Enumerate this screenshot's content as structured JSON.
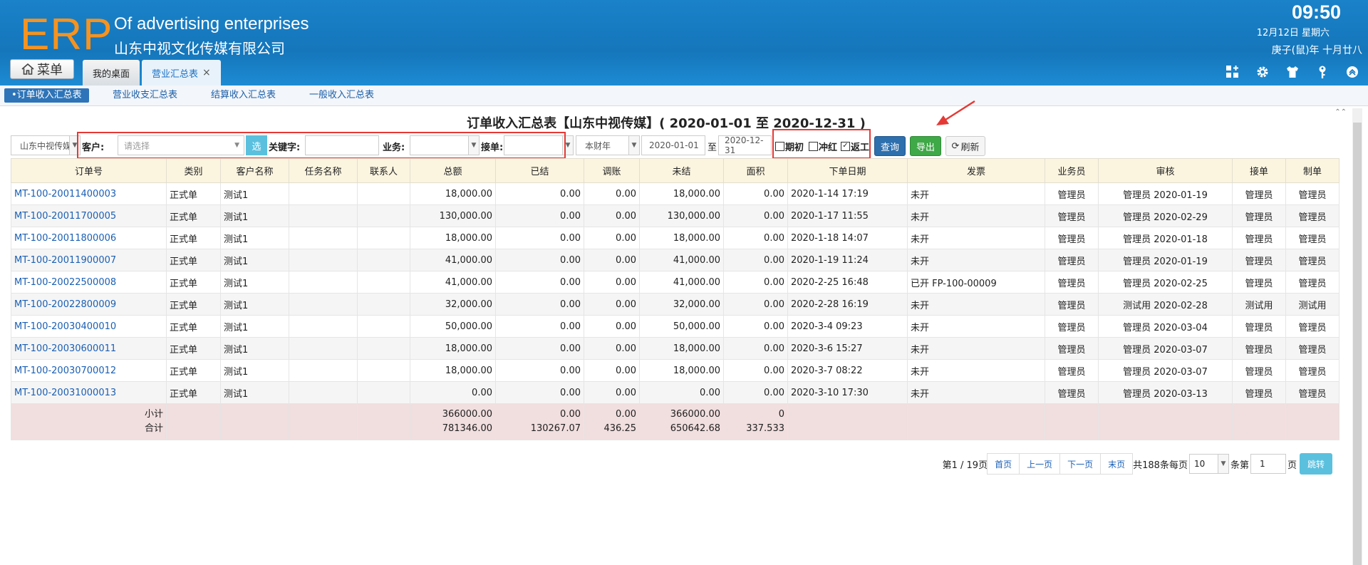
{
  "header": {
    "logo": "ERP",
    "title_en": "Of advertising enterprises",
    "title_cn": "山东中视文化传媒有限公司",
    "time": "09:50",
    "date": "12月12日 星期六",
    "lunar": "庚子(鼠)年 十月廿八",
    "menu_label": "菜单",
    "tabs": [
      {
        "label": "我的桌面",
        "active": false
      },
      {
        "label": "营业汇总表",
        "active": true
      }
    ]
  },
  "subnav": [
    {
      "label": "•订单收入汇总表",
      "active": true
    },
    {
      "label": "营业收支汇总表",
      "active": false
    },
    {
      "label": "结算收入汇总表",
      "active": false
    },
    {
      "label": "一般收入汇总表",
      "active": false
    }
  ],
  "report_title": "订单收入汇总表【山东中视传媒】( 2020-01-01 至 2020-12-31 )",
  "filters": {
    "company": "山东中视传媒",
    "customer_label": "客户:",
    "customer_placeholder": "请选择",
    "select_btn": "选",
    "keyword_label": "关键字:",
    "business_label": "业务:",
    "receiver_label": "接单:",
    "period": "本财年",
    "date_from": "2020-01-01",
    "to_label": "至",
    "date_to": "2020-12-31",
    "chk_initial": "期初",
    "chk_red": "冲红",
    "chk_rework": "返工",
    "query": "查询",
    "export": "导出",
    "refresh": "刷新"
  },
  "table": {
    "headers": [
      "订单号",
      "类别",
      "客户名称",
      "任务名称",
      "联系人",
      "总额",
      "已结",
      "调账",
      "未结",
      "面积",
      "下单日期",
      "发票",
      "业务员",
      "审核",
      "接单",
      "制单"
    ],
    "rows": [
      [
        "MT-100-20011400003",
        "正式单",
        "测试1",
        "",
        "",
        "18,000.00",
        "0.00",
        "0.00",
        "18,000.00",
        "0.00",
        "2020-1-14 17:19",
        "未开",
        "管理员",
        "管理员 2020-01-19",
        "管理员",
        "管理员"
      ],
      [
        "MT-100-20011700005",
        "正式单",
        "测试1",
        "",
        "",
        "130,000.00",
        "0.00",
        "0.00",
        "130,000.00",
        "0.00",
        "2020-1-17 11:55",
        "未开",
        "管理员",
        "管理员 2020-02-29",
        "管理员",
        "管理员"
      ],
      [
        "MT-100-20011800006",
        "正式单",
        "测试1",
        "",
        "",
        "18,000.00",
        "0.00",
        "0.00",
        "18,000.00",
        "0.00",
        "2020-1-18 14:07",
        "未开",
        "管理员",
        "管理员 2020-01-18",
        "管理员",
        "管理员"
      ],
      [
        "MT-100-20011900007",
        "正式单",
        "测试1",
        "",
        "",
        "41,000.00",
        "0.00",
        "0.00",
        "41,000.00",
        "0.00",
        "2020-1-19 11:24",
        "未开",
        "管理员",
        "管理员 2020-01-19",
        "管理员",
        "管理员"
      ],
      [
        "MT-100-20022500008",
        "正式单",
        "测试1",
        "",
        "",
        "41,000.00",
        "0.00",
        "0.00",
        "41,000.00",
        "0.00",
        "2020-2-25 16:48",
        "已开 FP-100-00009",
        "管理员",
        "管理员 2020-02-25",
        "管理员",
        "管理员"
      ],
      [
        "MT-100-20022800009",
        "正式单",
        "测试1",
        "",
        "",
        "32,000.00",
        "0.00",
        "0.00",
        "32,000.00",
        "0.00",
        "2020-2-28 16:19",
        "未开",
        "管理员",
        "测试用 2020-02-28",
        "测试用",
        "测试用"
      ],
      [
        "MT-100-20030400010",
        "正式单",
        "测试1",
        "",
        "",
        "50,000.00",
        "0.00",
        "0.00",
        "50,000.00",
        "0.00",
        "2020-3-4 09:23",
        "未开",
        "管理员",
        "管理员 2020-03-04",
        "管理员",
        "管理员"
      ],
      [
        "MT-100-20030600011",
        "正式单",
        "测试1",
        "",
        "",
        "18,000.00",
        "0.00",
        "0.00",
        "18,000.00",
        "0.00",
        "2020-3-6 15:27",
        "未开",
        "管理员",
        "管理员 2020-03-07",
        "管理员",
        "管理员"
      ],
      [
        "MT-100-20030700012",
        "正式单",
        "测试1",
        "",
        "",
        "18,000.00",
        "0.00",
        "0.00",
        "18,000.00",
        "0.00",
        "2020-3-7 08:22",
        "未开",
        "管理员",
        "管理员 2020-03-07",
        "管理员",
        "管理员"
      ],
      [
        "MT-100-20031000013",
        "正式单",
        "测试1",
        "",
        "",
        "0.00",
        "0.00",
        "0.00",
        "0.00",
        "0.00",
        "2020-3-10 17:30",
        "未开",
        "管理员",
        "管理员 2020-03-13",
        "管理员",
        "管理员"
      ]
    ],
    "subtotal_label": "小计",
    "total_label": "合计",
    "subtotal": {
      "total": "366000.00",
      "settled": "0.00",
      "adjust": "0.00",
      "unsettled": "366000.00",
      "area": "0"
    },
    "grand": {
      "total": "781346.00",
      "settled": "130267.07",
      "adjust": "436.25",
      "unsettled": "650642.68",
      "area": "337.533"
    }
  },
  "pager": {
    "page_info": "第1 / 19页",
    "first": "首页",
    "prev": "上一页",
    "next": "下一页",
    "last": "末页",
    "total_info": "共188条每页",
    "per_page": "10",
    "tiao_di": "条第",
    "page_input": "1",
    "ye": "页",
    "go": "跳转"
  },
  "colors": {
    "header_bg": "#1576bb",
    "logo": "#f7931e",
    "highlight": "#e53935",
    "export_btn": "#3fa847",
    "query_btn": "#2e6fad"
  }
}
